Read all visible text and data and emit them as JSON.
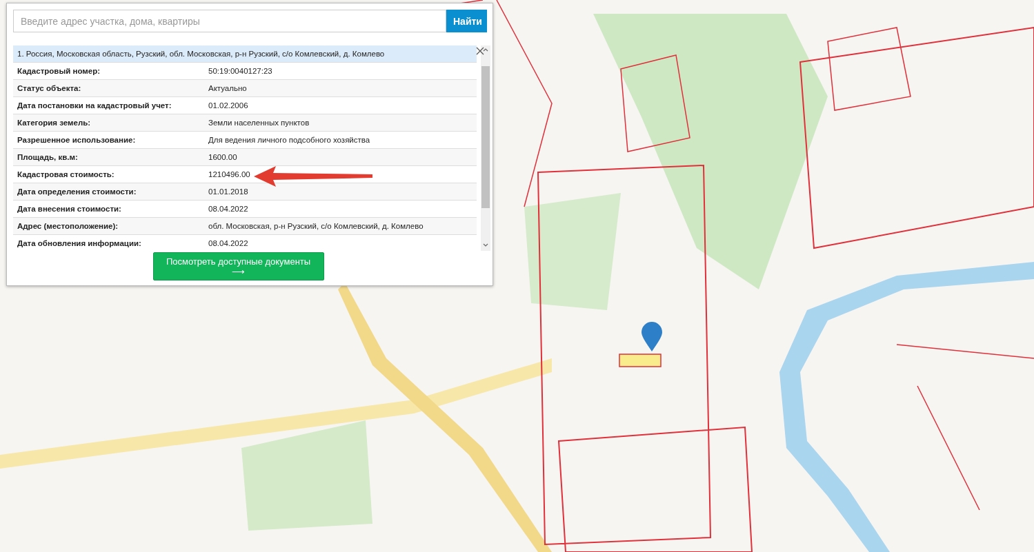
{
  "search": {
    "placeholder": "Введите адрес участка, дома, квартиры",
    "button": "Найти"
  },
  "result": {
    "title": "1. Россия, Московская область, Рузский, обл. Московская, р-н Рузский, с/о Комлевский, д. Комлево",
    "rows": [
      {
        "label": "Кадастровый номер:",
        "value": "50:19:0040127:23"
      },
      {
        "label": "Статус объекта:",
        "value": "Актуально"
      },
      {
        "label": "Дата постановки на кадастровый учет:",
        "value": "01.02.2006"
      },
      {
        "label": "Категория земель:",
        "value": "Земли населенных пунктов"
      },
      {
        "label": "Разрешенное использование:",
        "value": "Для ведения личного подсобного хозяйства"
      },
      {
        "label": "Площадь, кв.м:",
        "value": "1600.00"
      },
      {
        "label": "Кадастровая стоимость:",
        "value": "1210496.00"
      },
      {
        "label": "Дата определения стоимости:",
        "value": "01.01.2018"
      },
      {
        "label": "Дата внесения стоимости:",
        "value": "08.04.2022"
      },
      {
        "label": "Адрес (местоположение):",
        "value": "обл. Московская, р-н Рузский, с/о Комлевский, д. Комлево"
      },
      {
        "label": "Дата обновления информации:",
        "value": "08.04.2022"
      }
    ]
  },
  "documents_button": "Посмотреть доступные документы ⟶"
}
